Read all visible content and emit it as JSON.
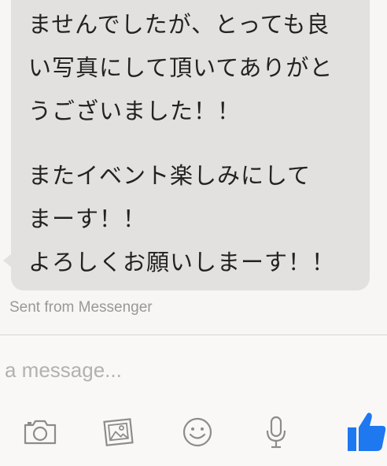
{
  "conversation": {
    "message": {
      "lines_top": [
        "ませんでしたが、とっても良",
        "い写真にして頂いてありがと",
        "うございました！！"
      ],
      "lines_bottom": [
        "またイベント楽しみにして",
        "まーす！！",
        "よろしくお願いしまーす！！"
      ]
    },
    "sent_from": "Sent from Messenger"
  },
  "composer": {
    "placeholder": "a message...",
    "value": ""
  },
  "toolbar": {
    "icons": [
      "camera-icon",
      "gallery-icon",
      "smiley-icon",
      "microphone-icon",
      "thumbs-up-icon"
    ]
  },
  "colors": {
    "bubble": "#e3e1df",
    "icon_gray": "#8e8c8a",
    "like_blue": "#1e78f0"
  }
}
